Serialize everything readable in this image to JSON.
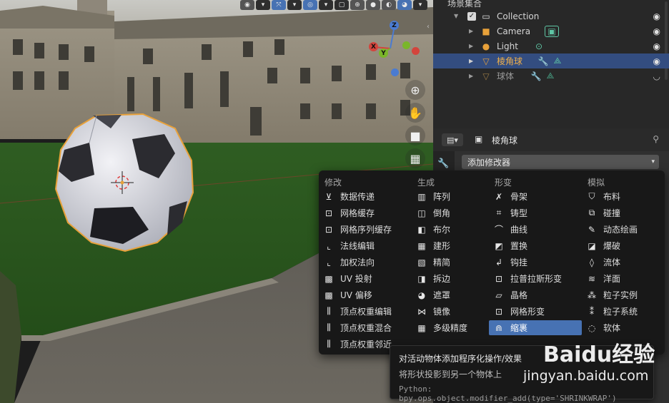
{
  "outliner": {
    "root_label": "场景集合",
    "rows": [
      {
        "label": "Collection",
        "icon": "collection-icon"
      },
      {
        "label": "Camera",
        "icon": "camera-icon",
        "extra_icon": "camera-data-icon"
      },
      {
        "label": "Light",
        "icon": "light-icon",
        "extra_icon": "light-data-icon"
      },
      {
        "label": "棱角球",
        "icon": "mesh-object-icon",
        "selected": true
      },
      {
        "label": "球体",
        "icon": "mesh-object-icon",
        "hidden": true
      }
    ]
  },
  "properties": {
    "object_name": "棱角球",
    "add_modifier_label": "添加修改器"
  },
  "menu": {
    "columns": [
      {
        "header": "修改",
        "items": [
          "数据传递",
          "网格缓存",
          "网格序列缓存",
          "法线编辑",
          "加权法向",
          "UV 投射",
          "UV 偏移",
          "顶点权重编辑",
          "顶点权重混合",
          "顶点权重邻近"
        ]
      },
      {
        "header": "生成",
        "items": [
          "阵列",
          "倒角",
          "布尔",
          "建形",
          "精简",
          "拆边",
          "遮罩",
          "镜像",
          "多级精度"
        ]
      },
      {
        "header": "形变",
        "items": [
          "骨架",
          "铸型",
          "曲线",
          "置换",
          "钩挂",
          "拉普拉斯形变",
          "晶格",
          "网格形变",
          "缩裹"
        ]
      },
      {
        "header": "模拟",
        "items": [
          "布料",
          "碰撞",
          "动态绘画",
          "爆破",
          "流体",
          "洋面",
          "粒子实例",
          "粒子系统",
          "软体"
        ]
      }
    ],
    "highlighted": "缩裹"
  },
  "tooltip": {
    "title": "对活动物体添加程序化操作/效果",
    "description": "将形状投影到另一个物体上",
    "python": "Python: bpy.ops.object.modifier_add(type='SHRINKWRAP')"
  },
  "watermark": {
    "brand": "Baidu经验",
    "url": "jingyan.baidu.com"
  },
  "colors": {
    "accent": "#4772b3",
    "selected_row": "#334d80",
    "menu_bg": "#181818",
    "object_orange": "#e8a13a"
  }
}
